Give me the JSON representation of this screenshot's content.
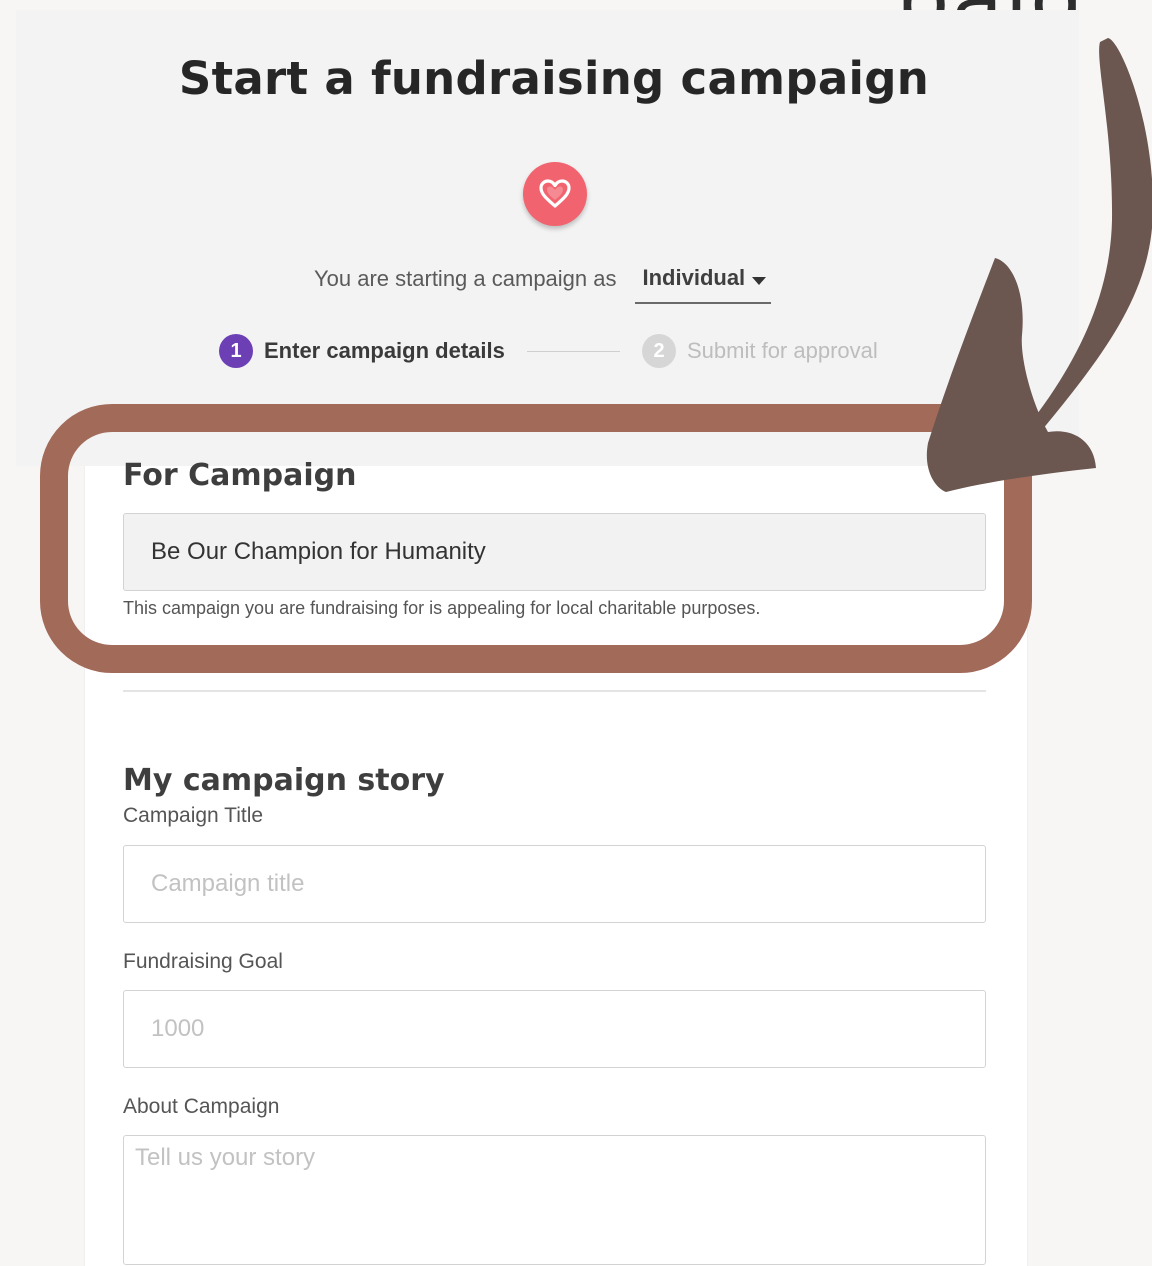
{
  "backdrop": {
    "cropped_heading_fragment": "paig"
  },
  "header": {
    "title": "Start a fundraising campaign",
    "heart_icon": "heart-outline-icon",
    "starting_as_text": "You are starting a campaign as",
    "starting_as_value": "Individual"
  },
  "stepper": {
    "steps": [
      {
        "number": "1",
        "label": "Enter campaign details",
        "state": "active"
      },
      {
        "number": "2",
        "label": "Submit for approval",
        "state": "inactive"
      }
    ]
  },
  "for_campaign": {
    "title": "For Campaign",
    "value": "Be Our Champion for Humanity",
    "help": "This campaign you are fundraising for is appealing for local charitable purposes."
  },
  "story": {
    "title": "My campaign story",
    "campaign_title_label": "Campaign Title",
    "campaign_title_placeholder": "Campaign title",
    "goal_label": "Fundraising Goal",
    "goal_placeholder": "1000",
    "about_label": "About Campaign",
    "about_placeholder": "Tell us your story"
  },
  "colors": {
    "accent_purple": "#6c3fb5",
    "heart_red": "#f1646f",
    "highlight_brown": "#a26a59",
    "arrow_brown": "#6b5650"
  }
}
